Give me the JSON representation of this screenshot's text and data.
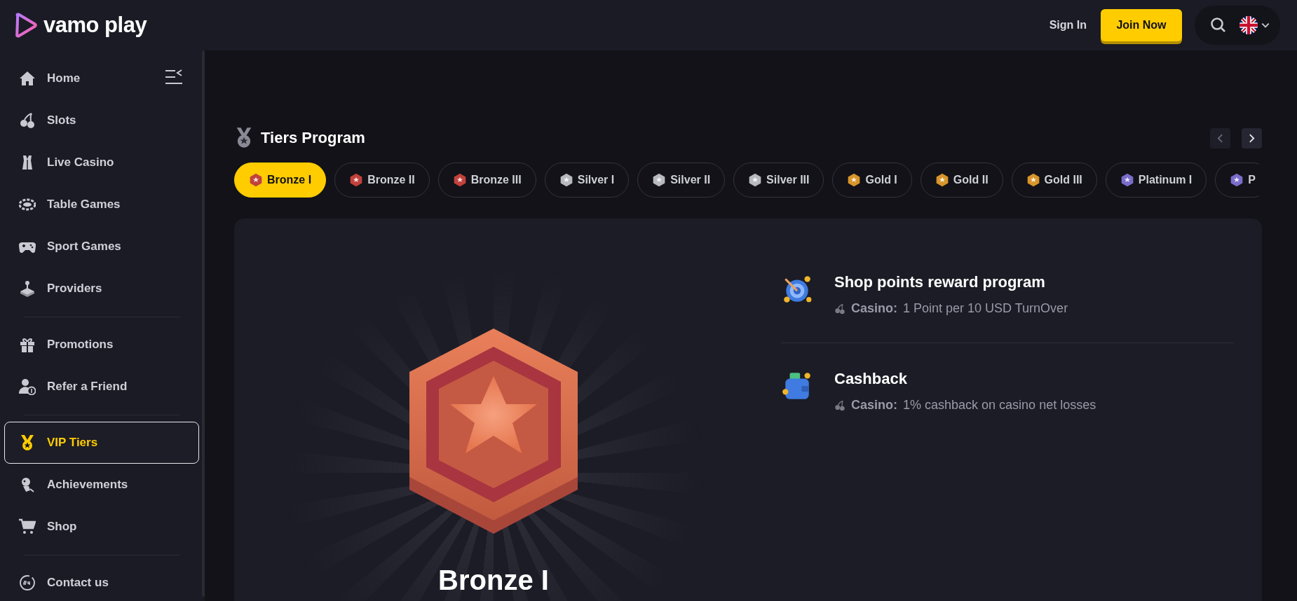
{
  "header": {
    "logo": "vamo play",
    "sign_in": "Sign In",
    "join": "Join Now"
  },
  "sidebar": {
    "groups": [
      {
        "items": [
          {
            "kind": "home",
            "label": "Home",
            "selected": false
          },
          {
            "kind": "cherries",
            "label": "Slots",
            "selected": false
          },
          {
            "kind": "dealer",
            "label": "Live Casino",
            "selected": false
          },
          {
            "kind": "table",
            "label": "Table Games",
            "selected": false
          },
          {
            "kind": "gamepad",
            "label": "Sport Games",
            "selected": false
          },
          {
            "kind": "joystick",
            "label": "Providers",
            "selected": false
          }
        ]
      },
      {
        "items": [
          {
            "kind": "gift",
            "label": "Promotions",
            "selected": false
          },
          {
            "kind": "refer",
            "label": "Refer a Friend",
            "selected": false
          }
        ]
      },
      {
        "items": [
          {
            "kind": "medal",
            "label": "VIP Tiers",
            "selected": true
          },
          {
            "kind": "trophy",
            "label": "Achievements",
            "selected": false
          },
          {
            "kind": "cart",
            "label": "Shop",
            "selected": false
          }
        ]
      },
      {
        "items": [
          {
            "kind": "support",
            "label": "Contact us",
            "selected": false
          }
        ]
      }
    ]
  },
  "tiers": {
    "title": "Tiers Program",
    "nav": [
      {
        "kind": "prev",
        "disabled": true
      },
      {
        "kind": "next",
        "disabled": false
      }
    ],
    "tabs": [
      {
        "label": "Bronze I",
        "color": "#c2413c",
        "selected": true
      },
      {
        "label": "Bronze II",
        "color": "#c2413c",
        "selected": false
      },
      {
        "label": "Bronze III",
        "color": "#c2413c",
        "selected": false
      },
      {
        "label": "Silver I",
        "color": "#b8b8c0",
        "selected": false
      },
      {
        "label": "Silver II",
        "color": "#b8b8c0",
        "selected": false
      },
      {
        "label": "Silver III",
        "color": "#b8b8c0",
        "selected": false
      },
      {
        "label": "Gold I",
        "color": "#d9952a",
        "selected": false
      },
      {
        "label": "Gold II",
        "color": "#d9952a",
        "selected": false
      },
      {
        "label": "Gold III",
        "color": "#d9952a",
        "selected": false
      },
      {
        "label": "Platinum I",
        "color": "#7a6cc9",
        "selected": false
      },
      {
        "label": "P",
        "color": "#7a6cc9",
        "selected": false
      }
    ]
  },
  "tier_card": {
    "name": "Bronze I",
    "rewards": [
      {
        "kind": "target",
        "title": "Shop points reward program",
        "label": "Casino:",
        "text": "1 Point per 10 USD TurnOver"
      },
      {
        "kind": "wallet",
        "title": "Cashback",
        "label": "Casino:",
        "text": "1% cashback on casino net losses"
      }
    ]
  }
}
